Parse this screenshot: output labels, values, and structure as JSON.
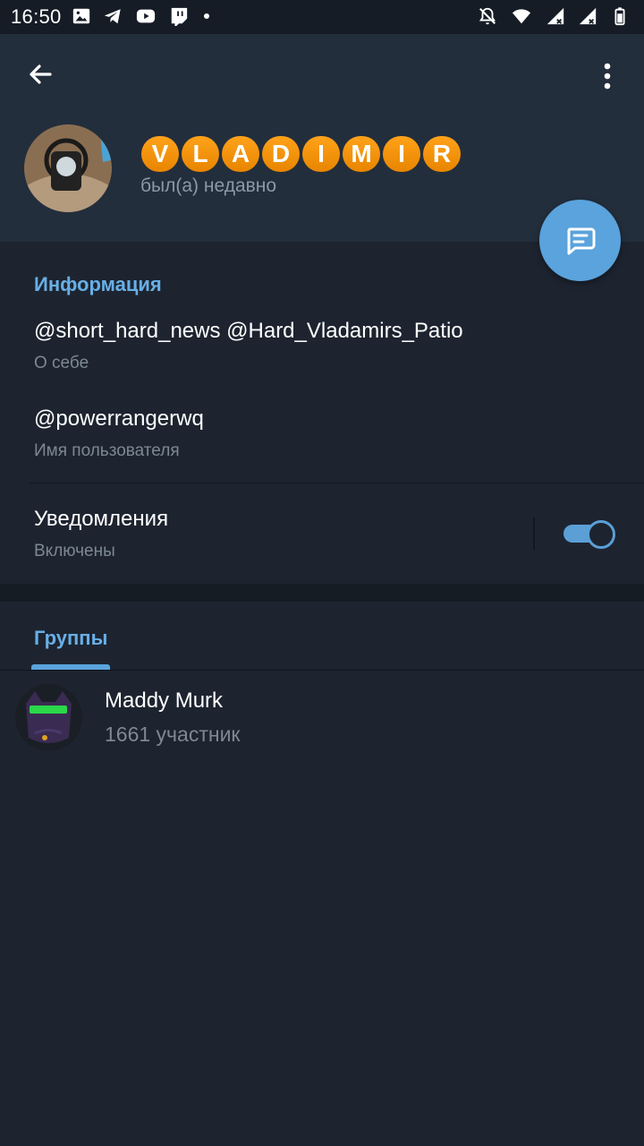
{
  "status_bar": {
    "time": "16:50",
    "left_icons": [
      "image-icon",
      "telegram-icon",
      "youtube-icon",
      "twitch-icon",
      "dot-icon"
    ],
    "right_icons": [
      "muted-bell-icon",
      "wifi-icon",
      "signal-icon",
      "signal-icon",
      "battery-icon"
    ]
  },
  "header": {
    "name_letters": [
      "V",
      "L",
      "A",
      "D",
      "I",
      "M",
      "I",
      "R"
    ],
    "last_seen": "был(а) недавно",
    "name_color": "#f39200"
  },
  "info": {
    "section_title": "Информация",
    "bio": "@short_hard_news @Hard_Vladamirs_Patio",
    "bio_label": "О себе",
    "username": "@powerrangerwq",
    "username_label": "Имя пользователя",
    "notifications": "Уведомления",
    "notifications_status": "Включены",
    "notifications_on": true
  },
  "groups": {
    "tab_label": "Группы",
    "items": [
      {
        "name": "Maddy Murk",
        "members": "1661 участник"
      }
    ]
  },
  "colors": {
    "accent": "#68afe6",
    "fab": "#5aa3dc",
    "background": "#1d2430",
    "header": "#232e3c"
  }
}
